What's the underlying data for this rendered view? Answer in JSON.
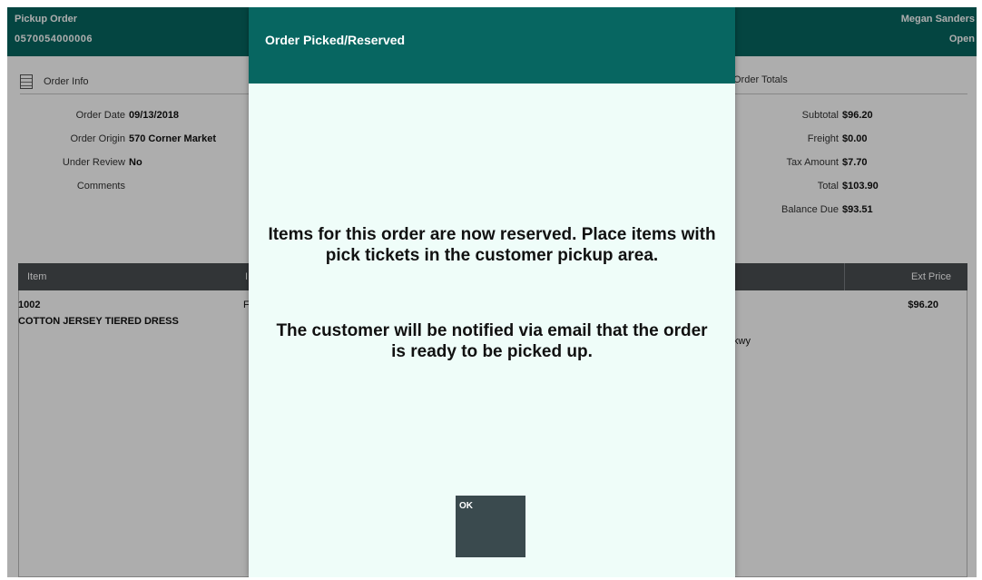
{
  "header": {
    "order_type": "Pickup Order",
    "order_number": "0570054000006",
    "user_name": "Megan Sanders",
    "status": "Open"
  },
  "order_info": {
    "title": "Order Info",
    "fields": [
      {
        "label": "Order Date",
        "value": "09/13/2018"
      },
      {
        "label": "Order Origin",
        "value": "570 Corner Market"
      },
      {
        "label": "Under Review",
        "value": "No"
      },
      {
        "label": "Comments",
        "value": ""
      }
    ]
  },
  "order_totals": {
    "title": "Order Totals",
    "fields": [
      {
        "label": "Subtotal",
        "value": "$96.20"
      },
      {
        "label": "Freight",
        "value": "$0.00"
      },
      {
        "label": "Tax Amount",
        "value": "$7.70"
      },
      {
        "label": "Total",
        "value": "$103.90"
      },
      {
        "label": "Balance Due",
        "value": "$93.51"
      }
    ]
  },
  "items_table": {
    "columns": {
      "item": "Item",
      "col2_fragment": "I",
      "ext_price": "Ext Price"
    },
    "rows": [
      {
        "sku": "1002",
        "description": "COTTON JERSEY TIERED DRESS",
        "col2_fragment": "F",
        "address_fragment": "kwy",
        "ext_price": "$96.20"
      }
    ]
  },
  "modal": {
    "title": "Order Picked/Reserved",
    "message_1": "Items for this order are now reserved.  Place items with pick tickets in the customer pickup area.",
    "message_2": "The customer will be notified via email that the order is ready to be picked up.",
    "ok_label": "OK"
  },
  "colors": {
    "header_teal": "#076661",
    "modal_background": "#effdf9",
    "button_dark": "#3a4a4e",
    "table_header": "#4a4e52"
  }
}
